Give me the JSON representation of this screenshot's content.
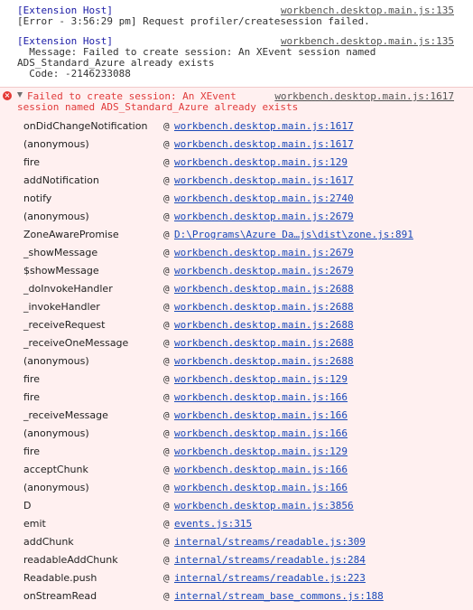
{
  "messages": [
    {
      "lines": [
        "[Extension Host]",
        "[Error - 3:56:29 pm] Request profiler/createsession failed."
      ],
      "source": "workbench.desktop.main.js:135"
    },
    {
      "lines": [
        "[Extension Host]",
        "  Message: Failed to create session: An XEvent session named",
        "ADS_Standard_Azure already exists",
        "  Code: -2146233088"
      ],
      "source": "workbench.desktop.main.js:135"
    }
  ],
  "error": {
    "title_line1": "Failed to create session: An XEvent",
    "title_line2": "session named ADS_Standard_Azure already exists",
    "source": "workbench.desktop.main.js:1617",
    "icon": "error-circle-icon",
    "frames": [
      {
        "fn": "onDidChangeNotification",
        "loc": "workbench.desktop.main.js:1617"
      },
      {
        "fn": "(anonymous)",
        "loc": "workbench.desktop.main.js:1617"
      },
      {
        "fn": "fire",
        "loc": "workbench.desktop.main.js:129"
      },
      {
        "fn": "addNotification",
        "loc": "workbench.desktop.main.js:1617"
      },
      {
        "fn": "notify",
        "loc": "workbench.desktop.main.js:2740"
      },
      {
        "fn": "(anonymous)",
        "loc": "workbench.desktop.main.js:2679"
      },
      {
        "fn": "ZoneAwarePromise",
        "loc": "D:\\Programs\\Azure Da…js\\dist\\zone.js:891"
      },
      {
        "fn": "_showMessage",
        "loc": "workbench.desktop.main.js:2679"
      },
      {
        "fn": "$showMessage",
        "loc": "workbench.desktop.main.js:2679"
      },
      {
        "fn": "_doInvokeHandler",
        "loc": "workbench.desktop.main.js:2688"
      },
      {
        "fn": "_invokeHandler",
        "loc": "workbench.desktop.main.js:2688"
      },
      {
        "fn": "_receiveRequest",
        "loc": "workbench.desktop.main.js:2688"
      },
      {
        "fn": "_receiveOneMessage",
        "loc": "workbench.desktop.main.js:2688"
      },
      {
        "fn": "(anonymous)",
        "loc": "workbench.desktop.main.js:2688"
      },
      {
        "fn": "fire",
        "loc": "workbench.desktop.main.js:129"
      },
      {
        "fn": "fire",
        "loc": "workbench.desktop.main.js:166"
      },
      {
        "fn": "_receiveMessage",
        "loc": "workbench.desktop.main.js:166"
      },
      {
        "fn": "(anonymous)",
        "loc": "workbench.desktop.main.js:166"
      },
      {
        "fn": "fire",
        "loc": "workbench.desktop.main.js:129"
      },
      {
        "fn": "acceptChunk",
        "loc": "workbench.desktop.main.js:166"
      },
      {
        "fn": "(anonymous)",
        "loc": "workbench.desktop.main.js:166"
      },
      {
        "fn": "D",
        "loc": "workbench.desktop.main.js:3856"
      },
      {
        "fn": "emit",
        "loc": "events.js:315"
      },
      {
        "fn": "addChunk",
        "loc": "internal/streams/readable.js:309"
      },
      {
        "fn": "readableAddChunk",
        "loc": "internal/streams/readable.js:284"
      },
      {
        "fn": "Readable.push",
        "loc": "internal/streams/readable.js:223"
      },
      {
        "fn": "onStreamRead",
        "loc": "internal/stream_base_commons.js:188"
      }
    ]
  },
  "at_symbol": "@"
}
